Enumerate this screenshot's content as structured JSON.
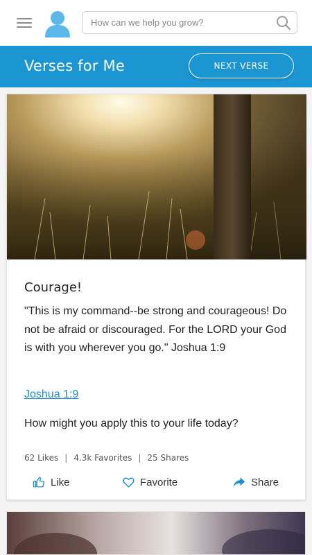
{
  "topbar": {
    "search_placeholder": "How can we help you grow?",
    "menu_icon": "hamburger-menu-icon",
    "avatar_icon": "user-avatar-icon",
    "search_icon": "search-icon"
  },
  "header": {
    "title": "Verses for Me",
    "next_label": "NEXT VERSE"
  },
  "card": {
    "title": "Courage!",
    "verse": "\"This is my command--be strong and courageous! Do not be afraid or discouraged. For the LORD your God is with you wherever you go.\" Joshua 1:9",
    "reference_link": "Joshua 1:9",
    "prompt": "How might you apply this to your life today?",
    "stats": {
      "likes": "62 Likes",
      "favorites": "4.3k Favorites",
      "shares": "25 Shares",
      "separator": "|"
    },
    "actions": {
      "like": "Like",
      "favorite": "Favorite",
      "share": "Share"
    }
  },
  "colors": {
    "brand_blue": "#1b96d3",
    "link_blue": "#1b8fcf",
    "avatar_blue": "#5bb8ea"
  }
}
